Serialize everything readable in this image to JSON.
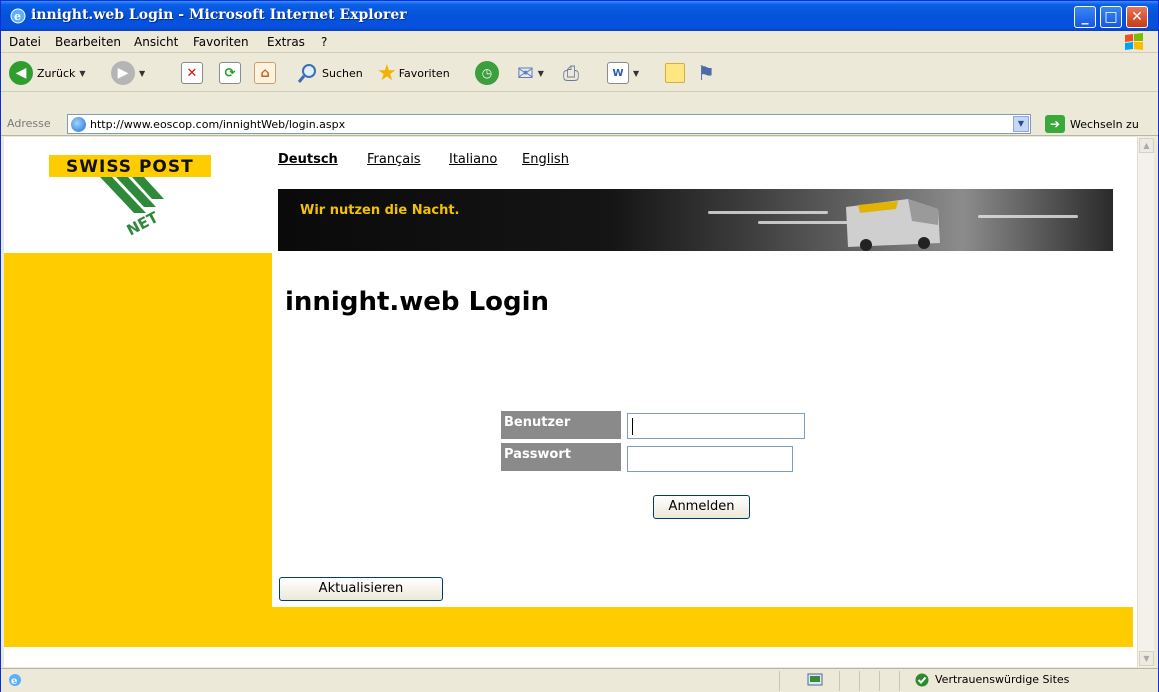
{
  "window": {
    "title": "innight.web Login - Microsoft Internet Explorer"
  },
  "menu": {
    "items": [
      "Datei",
      "Bearbeiten",
      "Ansicht",
      "Favoriten",
      "Extras",
      "?"
    ]
  },
  "toolbar": {
    "back_label": "Zurück",
    "search_label": "Suchen",
    "favorites_label": "Favoriten"
  },
  "address": {
    "label": "Adresse",
    "url": "http://www.eoscop.com/innightWeb/login.aspx",
    "go_label": "Wechseln zu"
  },
  "page": {
    "logo_text": "SWISS POST",
    "logo_sub": "NET",
    "languages": [
      "Deutsch",
      "Français",
      "Italiano",
      "English"
    ],
    "active_language": "Deutsch",
    "banner_text": "Wir nutzen die Nacht.",
    "heading": "innight.web Login",
    "user_label": "Benutzer",
    "user_value": "",
    "password_label": "Passwort",
    "password_value": "",
    "login_button": "Anmelden",
    "refresh_button": "Aktualisieren"
  },
  "status": {
    "zone_text": "Vertrauenswürdige Sites"
  },
  "colors": {
    "brand_yellow": "#ffcc00",
    "label_gray": "#8a8a8a",
    "banner_text": "#f2c200",
    "xp_blue": "#0552d8"
  }
}
